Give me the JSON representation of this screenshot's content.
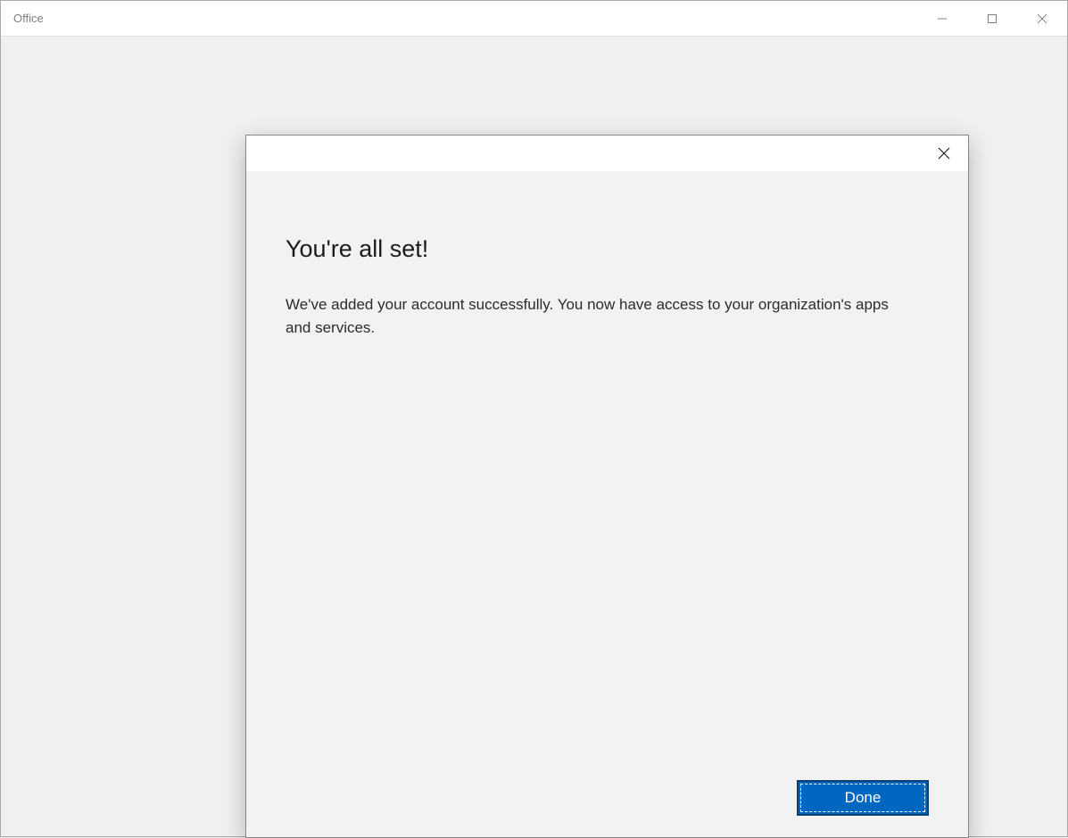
{
  "window": {
    "title": "Office"
  },
  "dialog": {
    "title": "You're all set!",
    "message": "We've added your account successfully. You now have access to your organization's apps and services.",
    "done_label": "Done"
  }
}
